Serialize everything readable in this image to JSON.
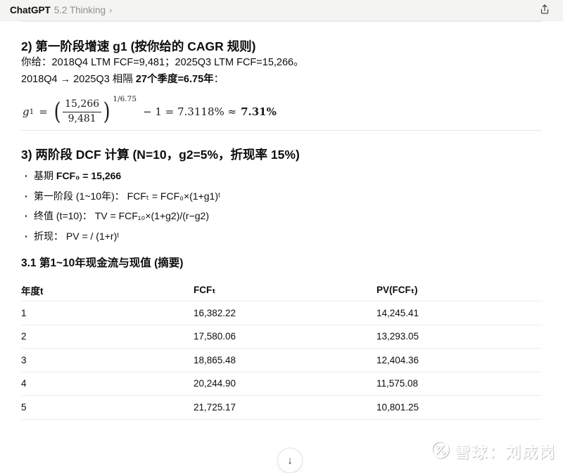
{
  "topbar": {
    "brand": "ChatGPT",
    "model": "5.2 Thinking",
    "chevron": "›"
  },
  "section_g1": {
    "heading": "2) 第一阶段增速 g1 (按你给的 CAGR 规则)",
    "line1": "你给：2018Q4 LTM FCF=9,481；2025Q3 LTM FCF=15,266。",
    "line2_prefix": "2018Q4 → 2025Q3 相隔 ",
    "line2_bold": "27个季度=6.75年",
    "line2_suffix": "：",
    "formula": {
      "var": "g",
      "var_sub": "1",
      "eq": "=",
      "lparen": "(",
      "rparen": ")",
      "numerator": "15,266",
      "denominator": "9,481",
      "exponent": "1/6.75",
      "middle": "− 1 = 7.3118% ≈",
      "result": "7.31%"
    }
  },
  "section_dcf": {
    "heading": "3) 两阶段 DCF 计算 (N=10，g2=5%，折现率 15%)",
    "bullets": [
      {
        "marker": "·",
        "prefix": "基期 ",
        "bold": "FCF₀ = 15,266"
      },
      {
        "marker": "·",
        "prefix": "第一阶段 (1~10年)：  FCFₜ = FCF₀×(1+g1)ᵗ",
        "bold": ""
      },
      {
        "marker": "·",
        "prefix": "终值 (t=10)：  TV = FCF₁₀×(1+g2)/(r−g2)",
        "bold": ""
      },
      {
        "marker": "·",
        "prefix": "折现：  PV = / (1+r)ᵗ",
        "bold": ""
      }
    ],
    "subheading": "3.1 第1~10年现金流与现值 (摘要)"
  },
  "table": {
    "headers": {
      "col1": "年度t",
      "col2": "FCFₜ",
      "col3": "PV(FCFₜ)"
    },
    "rows": [
      {
        "t": "1",
        "fcf": "16,382.22",
        "pv": "14,245.41"
      },
      {
        "t": "2",
        "fcf": "17,580.06",
        "pv": "13,293.05"
      },
      {
        "t": "3",
        "fcf": "18,865.48",
        "pv": "12,404.36"
      },
      {
        "t": "4",
        "fcf": "20,244.90",
        "pv": "11,575.08"
      },
      {
        "t": "5",
        "fcf": "21,725.17",
        "pv": "10,801.25"
      }
    ]
  },
  "scroll_button": {
    "arrow": "↓"
  },
  "watermark": {
    "text": "雪球：刘成岗"
  },
  "colors": {
    "topbar_bg": "#f4f4f2",
    "text": "#0d0d0d",
    "muted": "#8f8f8f",
    "divider": "#e7e7e7",
    "table_border": "#ececec"
  }
}
